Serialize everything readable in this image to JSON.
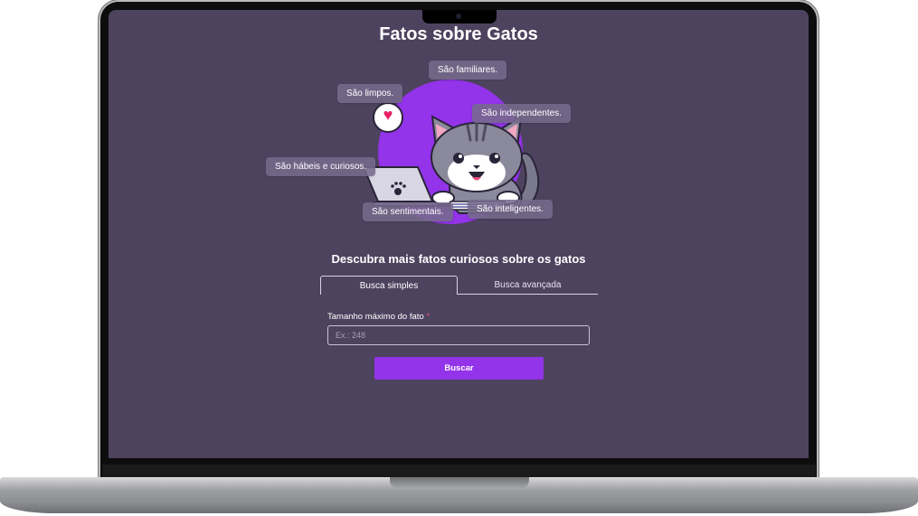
{
  "page": {
    "title": "Fatos sobre Gatos",
    "subtitle": "Descubra mais fatos curiosos sobre os gatos"
  },
  "hero": {
    "facts": [
      "São familiares.",
      "São limpos.",
      "São independentes.",
      "São hábeis e curiosos.",
      "São sentimentais.",
      "São inteligentes."
    ],
    "bubble_icon": "heart-icon",
    "laptop_icon": "paw-icon"
  },
  "tabs": [
    {
      "label": "Busca simples",
      "active": true
    },
    {
      "label": "Busca avançada",
      "active": false
    }
  ],
  "form": {
    "label": "Tamanho máximo do fato",
    "required_mark": "*",
    "placeholder": "Ex.: 248",
    "value": "",
    "submit_label": "Buscar"
  },
  "colors": {
    "background": "#4e435f",
    "accent": "#9333ea",
    "required": "#f04e78"
  }
}
